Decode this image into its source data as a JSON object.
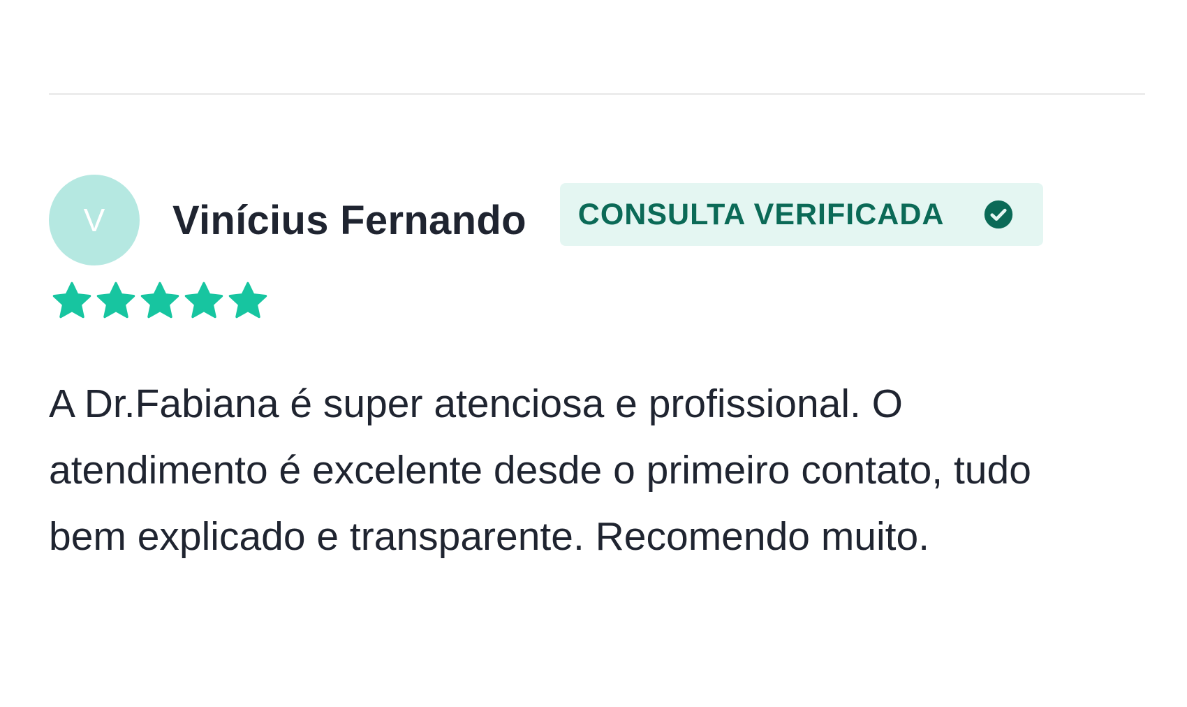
{
  "review": {
    "avatar_initial": "V",
    "reviewer_name": "Vinícius Fernando",
    "badge_label": "CONSULTA VERIFICADA",
    "badge_icon": "check-circle-icon",
    "rating": {
      "value": 5,
      "max": 5
    },
    "text": "A Dr.Fabiana é super atenciosa e profissional. O atendimento é excelente desde o primeiro contato, tudo bem explicado e transparente. Recomendo muito."
  },
  "colors": {
    "avatar_bg": "#b5e8e1",
    "badge_bg": "#e4f6f2",
    "badge_text": "#0b6a57",
    "star": "#17c5a0",
    "text": "#1f2430"
  }
}
